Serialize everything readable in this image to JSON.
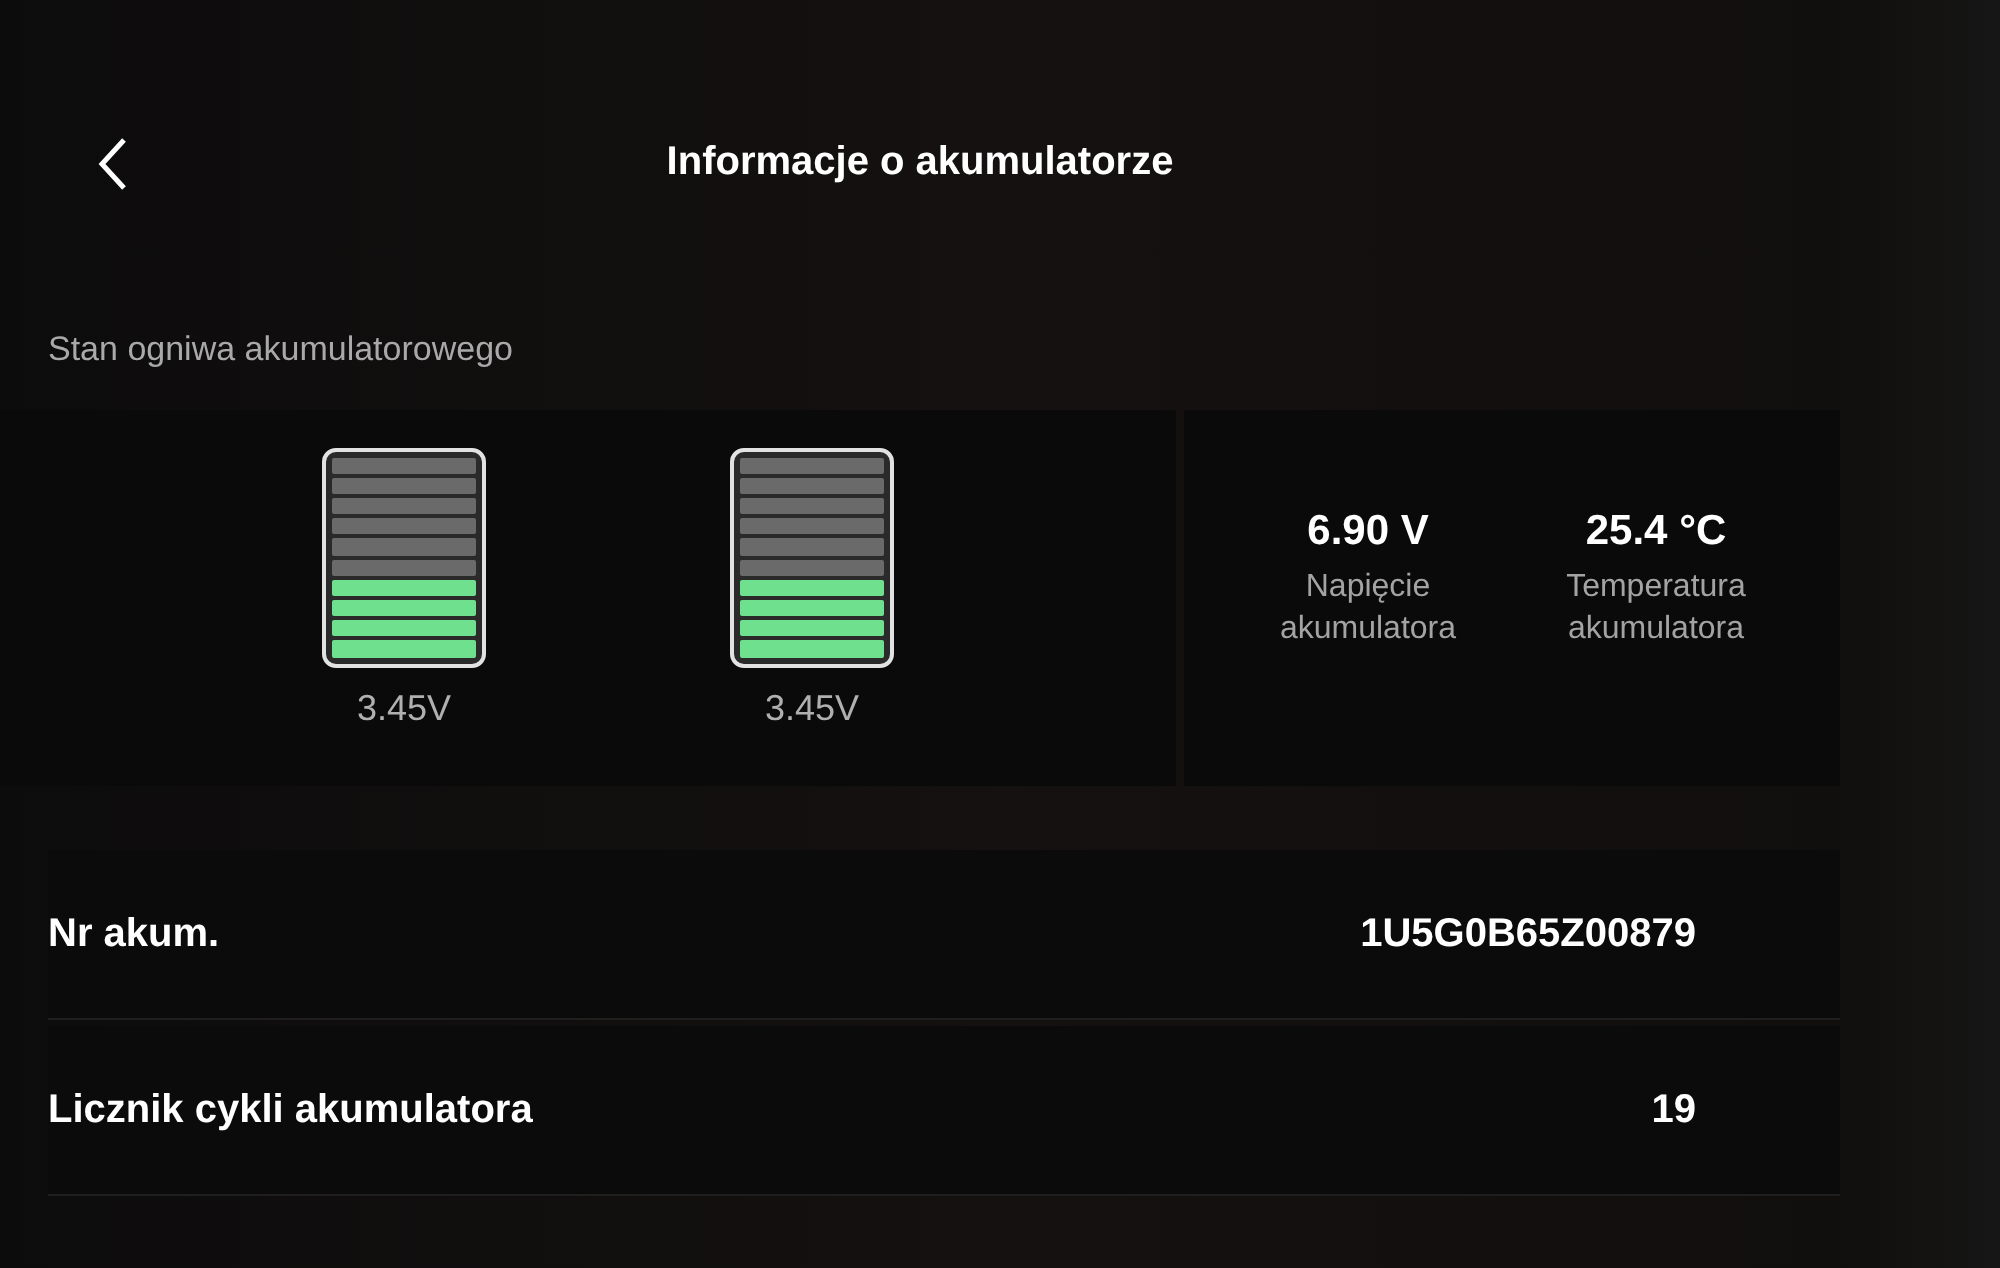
{
  "header": {
    "title": "Informacje o akumulatorze"
  },
  "cell_section": {
    "label": "Stan ogniwa akumulatorowego",
    "cells": [
      {
        "level": 0.4,
        "reading": "3.45V"
      },
      {
        "level": 0.4,
        "reading": "3.45V"
      }
    ]
  },
  "stats": [
    {
      "value": "6.90 V",
      "label": "Napięcie akumulatora"
    },
    {
      "value": "25.4 °C",
      "label": "Temperatura akumulatora"
    }
  ],
  "rows": [
    {
      "label": "Nr akum.",
      "value": "1U5G0B65Z00879"
    },
    {
      "label": "Licznik cykli akumulatora",
      "value": "19"
    }
  ]
}
